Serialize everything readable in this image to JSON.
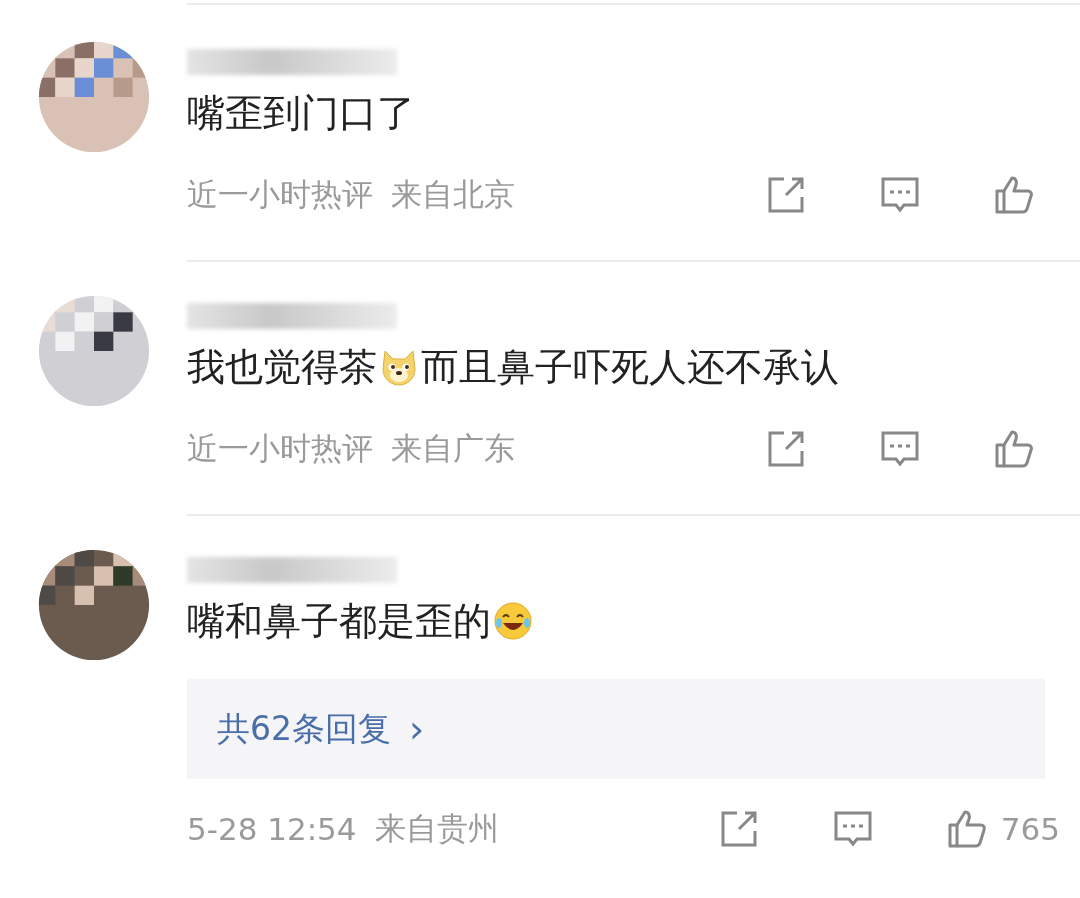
{
  "comments": [
    {
      "avatar": {
        "kind": "picture"
      },
      "content": [
        {
          "kind": "text",
          "text": "嘴歪到门口了"
        }
      ],
      "time": "近一小时热评",
      "location": "来自北京"
    },
    {
      "avatar": {
        "kind": "picture"
      },
      "content": [
        {
          "kind": "text",
          "text": "我也觉得茶"
        },
        {
          "kind": "doge"
        },
        {
          "kind": "text",
          "text": "而且鼻子吓死人还不承认"
        }
      ],
      "time": "近一小时热评",
      "location": "来自广东"
    },
    {
      "avatar": {
        "kind": "picture"
      },
      "content": [
        {
          "kind": "text",
          "text": "嘴和鼻子都是歪的"
        },
        {
          "kind": "laugh"
        }
      ],
      "replies": {
        "label": "共62条回复",
        "arrow": "›"
      },
      "time": "5-28 12:54",
      "location": "来自贵州",
      "likes": "765"
    }
  ]
}
